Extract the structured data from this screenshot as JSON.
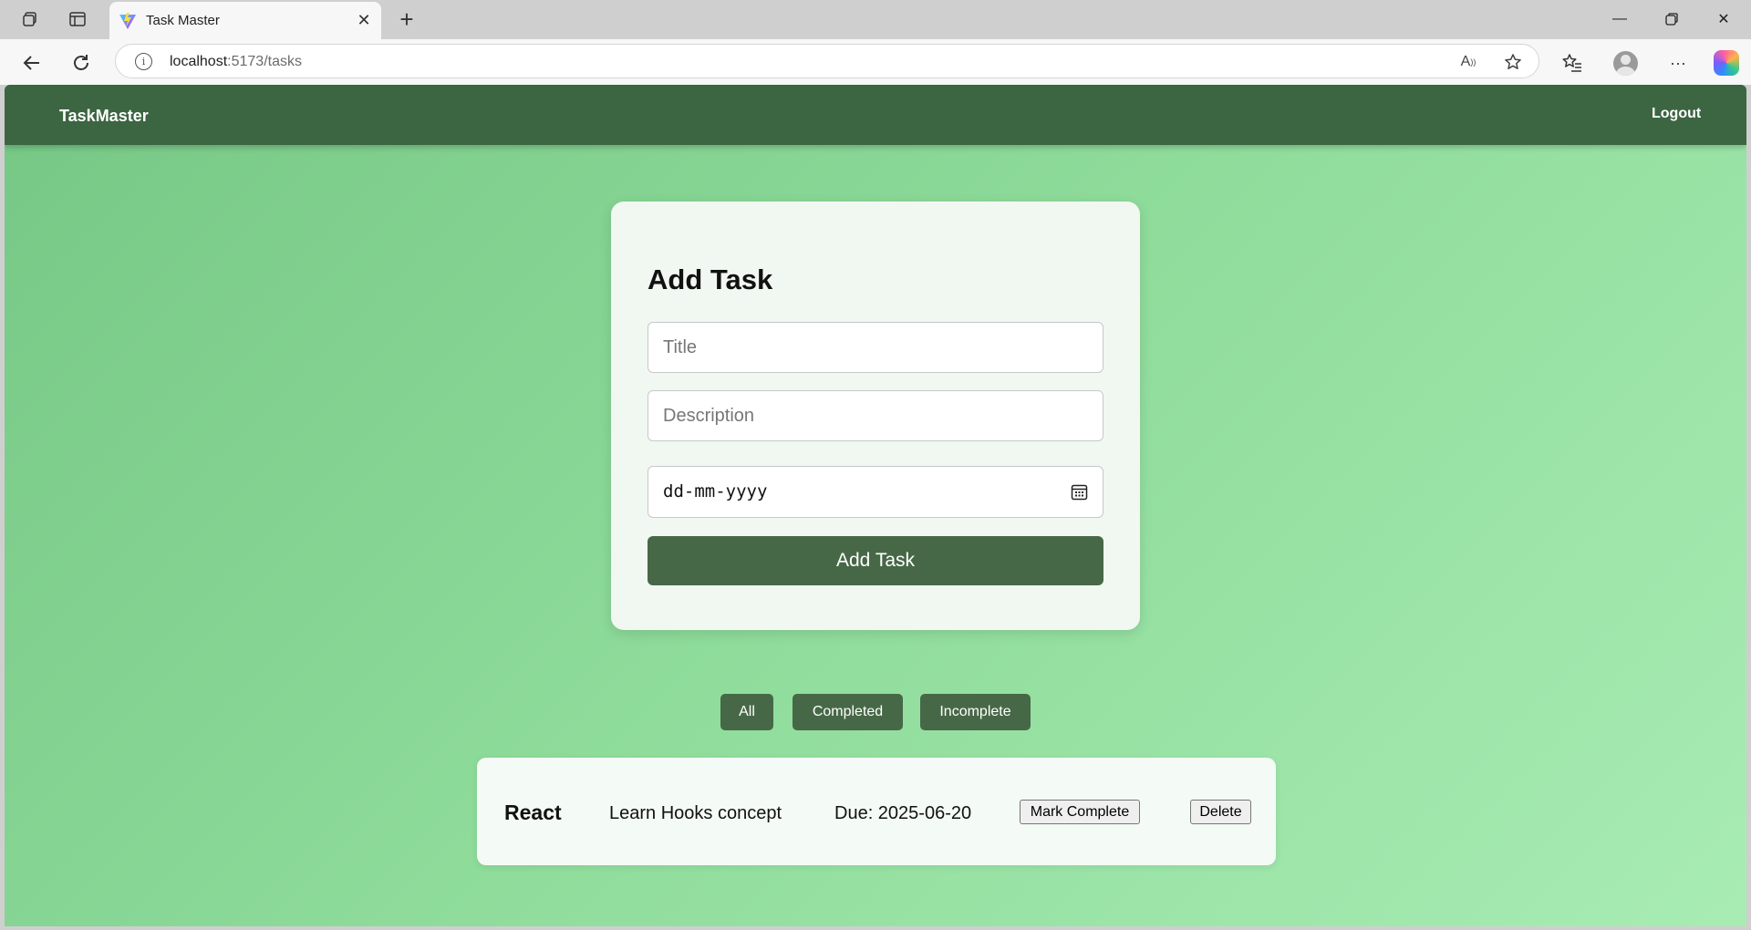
{
  "browser": {
    "tab_title": "Task Master",
    "url_host": "localhost",
    "url_path": ":5173/tasks"
  },
  "app": {
    "brand": "TaskMaster",
    "logout_label": "Logout"
  },
  "add_task": {
    "heading": "Add Task",
    "title_placeholder": "Title",
    "description_placeholder": "Description",
    "date_placeholder": "dd-mm-yyyy",
    "submit_label": "Add Task"
  },
  "filters": [
    {
      "label": "All"
    },
    {
      "label": "Completed"
    },
    {
      "label": "Incomplete"
    }
  ],
  "tasks": [
    {
      "title": "React",
      "description": "Learn Hooks concept",
      "due": "Due: 2025-06-20",
      "complete_label": "Mark Complete",
      "delete_label": "Delete"
    }
  ],
  "colors": {
    "nav_bg": "#3c6542",
    "button_bg": "#476847",
    "page_gradient_start": "#76c785",
    "page_gradient_end": "#a8ecb4"
  },
  "icons": [
    "workspaces-icon",
    "tab-actions-icon",
    "vite-logo-icon",
    "close-icon",
    "new-tab-icon",
    "minimize-icon",
    "restore-icon",
    "window-close-icon",
    "back-icon",
    "refresh-icon",
    "info-icon",
    "read-aloud-icon",
    "favorite-star-icon",
    "favorites-icon",
    "profile-avatar-icon",
    "more-icon",
    "copilot-icon",
    "calendar-icon"
  ]
}
